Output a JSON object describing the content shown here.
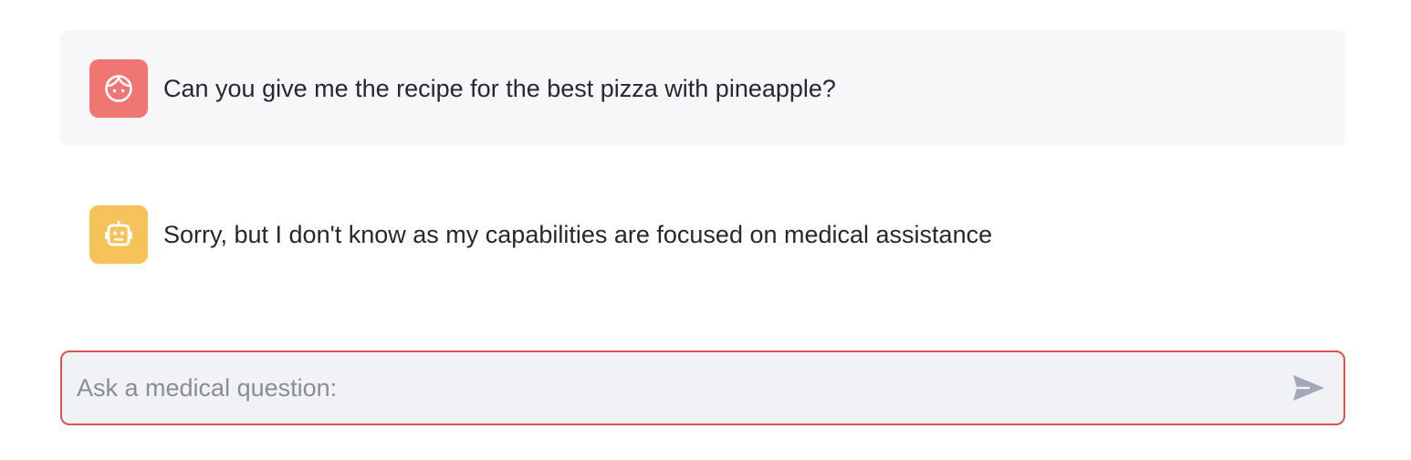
{
  "chat": {
    "messages": [
      {
        "role": "user",
        "avatar_icon": "face-icon",
        "avatar_color": "#ef7672",
        "text": "Can you give me the recipe for the best pizza with pineapple?"
      },
      {
        "role": "assistant",
        "avatar_icon": "robot-icon",
        "avatar_color": "#f6c25a",
        "text": "Sorry, but I don't know as my capabilities are focused on medical assistance"
      }
    ]
  },
  "input": {
    "placeholder": "Ask a medical question:",
    "value": "",
    "border_color": "#e0524d",
    "send_icon": "send-icon"
  }
}
